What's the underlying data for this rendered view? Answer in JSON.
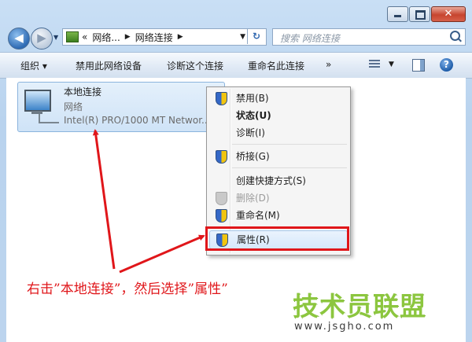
{
  "window": {
    "caption": {
      "minimize_icon": "minimize-icon",
      "maximize_icon": "maximize-icon",
      "close_label": "✕"
    }
  },
  "address_bar": {
    "back_glyph": "◀",
    "forward_glyph": "▶",
    "prefix": "«",
    "segments": [
      "网络...",
      "网络连接"
    ],
    "separator": "▶",
    "dropdown": "▼",
    "refresh_glyph": "↻"
  },
  "search": {
    "placeholder": "搜索 网络连接"
  },
  "command_bar": {
    "organize": "组织 ▾",
    "disable": "禁用此网络设备",
    "diagnose": "诊断这个连接",
    "rename": "重命名此连接",
    "more": "»",
    "view_drop": "▼",
    "help": "?"
  },
  "connection": {
    "name": "本地连接",
    "network": "网络",
    "adapter": "Intel(R) PRO/1000 MT Networ..."
  },
  "context_menu": {
    "items": [
      {
        "label": "禁用(B)",
        "shield": true,
        "bold": false,
        "disabled": false
      },
      {
        "label": "状态(U)",
        "shield": false,
        "bold": true,
        "disabled": false
      },
      {
        "label": "诊断(I)",
        "shield": false,
        "bold": false,
        "disabled": false
      },
      {
        "label": "桥接(G)",
        "shield": true,
        "bold": false,
        "disabled": false
      },
      {
        "label": "创建快捷方式(S)",
        "shield": false,
        "bold": false,
        "disabled": false
      },
      {
        "label": "删除(D)",
        "shield": true,
        "bold": false,
        "disabled": true
      },
      {
        "label": "重命名(M)",
        "shield": true,
        "bold": false,
        "disabled": false
      },
      {
        "label": "属性(R)",
        "shield": true,
        "bold": false,
        "disabled": false,
        "highlighted": true
      }
    ]
  },
  "annotation": {
    "text": "右击”本地连接”，然后选择”属性”",
    "color": "#e0161a"
  },
  "watermark": {
    "logo": "技术员联盟",
    "url": "www.jsgho.com"
  },
  "colors": {
    "accent": "#e0161a",
    "logo_green": "#8cc63f",
    "selection_blue": "#cfe3f7"
  }
}
